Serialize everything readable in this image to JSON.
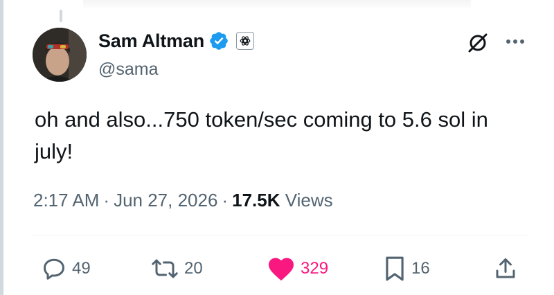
{
  "tweet": {
    "author": {
      "display_name": "Sam Altman",
      "handle": "@sama",
      "verified": true,
      "org_badge": "openai-logo-icon"
    },
    "text_line1": "oh and also...750 token/sec coming to 5.6 sol in",
    "text_line2": "july!",
    "timestamp": {
      "time": "2:17 AM",
      "separator": "·",
      "date": "Jun 27, 2026",
      "views_count": "17.5K",
      "views_label": "Views"
    },
    "actions": {
      "reply_count": "49",
      "retweet_count": "20",
      "like_count": "329",
      "bookmark_count": "16"
    },
    "colors": {
      "verified_blue": "#1d9bf0",
      "like_pink": "#f91880",
      "secondary_text": "#536471",
      "primary_text": "#0f1419"
    }
  }
}
